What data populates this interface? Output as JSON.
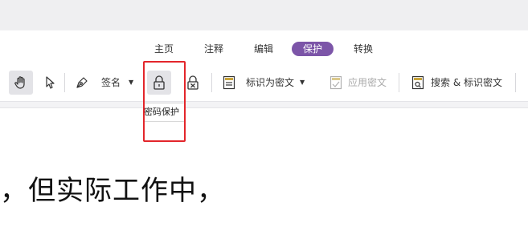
{
  "tabs": [
    {
      "label": "主页",
      "active": false
    },
    {
      "label": "注释",
      "active": false
    },
    {
      "label": "编辑",
      "active": false
    },
    {
      "label": "保护",
      "active": true
    },
    {
      "label": "转换",
      "active": false
    }
  ],
  "toolbar": {
    "sign_label": "签名",
    "mark_redact_label": "标识为密文",
    "apply_redact_label": "应用密文",
    "search_redact_label": "搜索 & 标识密文"
  },
  "tooltip": {
    "text": "密码保护"
  },
  "document": {
    "text": "，但实际工作中，"
  },
  "icons": {
    "hand": "hand-tool-icon",
    "select": "pointer-icon",
    "sign": "pen-nib-icon",
    "lock": "lock-icon",
    "unlock": "remove-security-icon",
    "mark_redact": "redact-mark-icon",
    "apply_redact": "redact-apply-icon",
    "search_redact": "redact-search-icon"
  },
  "colors": {
    "active_tab": "#7c55a8",
    "highlight": "#e3262b"
  }
}
